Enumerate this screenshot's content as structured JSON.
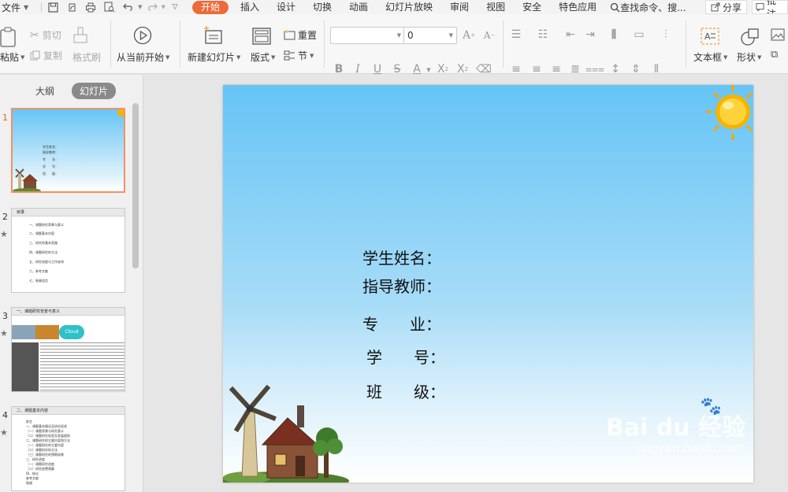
{
  "menubar": {
    "file_label": "文件",
    "tabs": [
      "开始",
      "插入",
      "设计",
      "切换",
      "动画",
      "幻灯片放映",
      "审阅",
      "视图",
      "安全",
      "特色应用"
    ],
    "active_tab": "开始",
    "search_label": "查找命令、搜...",
    "share_label": "分享",
    "comment_label": "批注"
  },
  "ribbon": {
    "paste_label": "粘贴",
    "cut_label": "剪切",
    "copy_label": "复制",
    "format_painter_label": "格式刷",
    "play_from_current_label": "从当前开始",
    "new_slide_label": "新建幻灯片",
    "layout_label": "版式",
    "reset_label": "重置",
    "section_label": "节",
    "font_size_value": "0",
    "textbox_label": "文本框",
    "shape_label": "形状"
  },
  "left_panel": {
    "tabs": [
      "大纲",
      "幻灯片"
    ],
    "active_tab": "幻灯片",
    "slides": [
      {
        "number": "1",
        "title": ""
      },
      {
        "number": "2",
        "title": "目录"
      },
      {
        "number": "3",
        "title": "一、课题研究背景与意义"
      },
      {
        "number": "4",
        "title": "二、课题基本内容"
      }
    ],
    "slide1_lines": [
      "学生姓名：",
      "指导教师：",
      "专　　业：",
      "学　　号：",
      "班　　级："
    ],
    "slide2_items": [
      "一、课题研究背景与意义",
      "二、课题基本内容",
      "三、研究的基本思路",
      "四、课题研究的方法",
      "五、研究进度与工作安排",
      "六、参考文献",
      "七、致谢语言"
    ],
    "slide3_cloud_label": "Cloud",
    "slide4_items": [
      "前言",
      "一、课题基本情况及研究现状",
      "（一）课题背景与研究意义",
      "（二）课题研究现状及发展趋势",
      "二、课题研究的主要内容和方法",
      "（一）课题研究的主要内容",
      "（二）课题研究的方法",
      "（三）课题研究的预期成果",
      "三、研究进度",
      "（一）课题研究进度",
      "（二）研究经费预算",
      "四、结论",
      "参考文献",
      "致谢"
    ]
  },
  "slide": {
    "lines": [
      {
        "label": "学生姓名："
      },
      {
        "label": "指导教师："
      },
      {
        "label": "专　　业："
      },
      {
        "label": "学　　号："
      },
      {
        "label": "班　　级："
      }
    ]
  },
  "watermark": {
    "brand": "Bai du 经验",
    "url": "jingyan.baidu.com"
  },
  "colors": {
    "accent": "#ec6b3a",
    "slide_sky_top": "#66c4f6",
    "slide_sky_bottom": "#ddf1fb",
    "thumb_selected_border": "#f29161"
  }
}
